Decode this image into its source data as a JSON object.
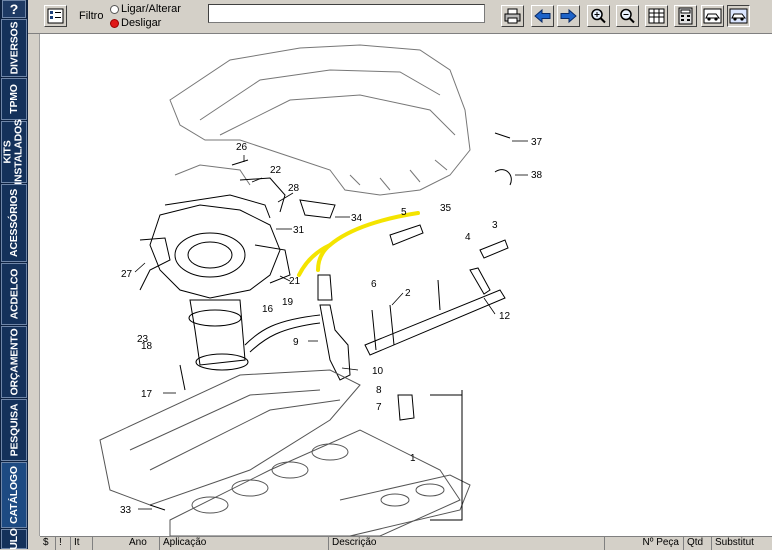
{
  "sidebar": {
    "help_label": "?",
    "tabs": [
      {
        "label": "DIVERSOS"
      },
      {
        "label": "TPMO"
      },
      {
        "label": "KITS INSTALADOS"
      },
      {
        "label": "ACESSÓRIOS"
      },
      {
        "label": "ACDELCO"
      },
      {
        "label": "ORÇAMENTO"
      },
      {
        "label": "PESQUISA"
      },
      {
        "label": "CATÁLOGO"
      },
      {
        "label": "ULO"
      }
    ]
  },
  "toolbar": {
    "filter_label": "Filtro",
    "option_on": "Ligar/Alterar",
    "option_off": "Desligar",
    "selected_option": "Desligar",
    "search_value": "",
    "icons": [
      "catalog-list-icon",
      "print-icon",
      "back-arrow-icon",
      "forward-arrow-icon",
      "zoom-in-icon",
      "zoom-out-icon",
      "grid-view-icon",
      "calculator-icon",
      "car-icon",
      "car-selected-icon"
    ]
  },
  "diagram": {
    "callouts": [
      "37",
      "38",
      "35",
      "5",
      "3",
      "4",
      "34",
      "26",
      "22",
      "28",
      "31",
      "27",
      "21",
      "6",
      "2",
      "12",
      "19",
      "16",
      "23",
      "18",
      "9",
      "10",
      "8",
      "7",
      "17",
      "1",
      "33"
    ],
    "highlight_color": "#f4e400"
  },
  "table": {
    "columns": [
      "$",
      "!",
      "It",
      "Ano",
      "Aplicação",
      "Descrição",
      "Nº Peça",
      "Qtd",
      "Substitut"
    ]
  }
}
